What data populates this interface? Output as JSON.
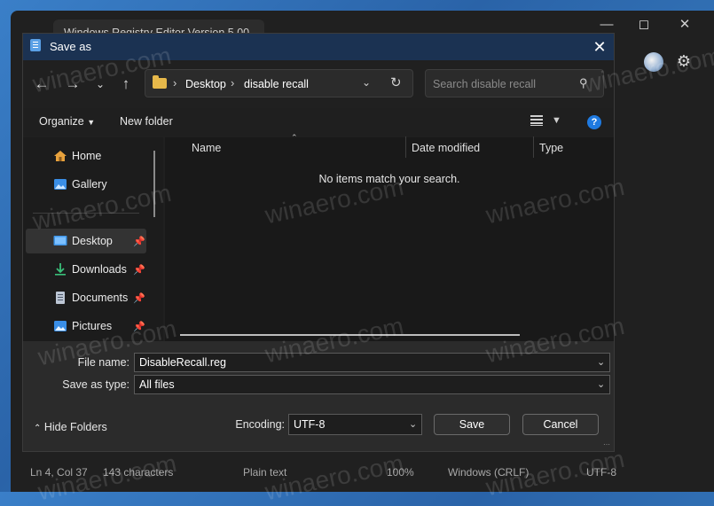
{
  "background_window": {
    "tab_title": "Windows Registry Editor Version 5.00",
    "status": {
      "position": "Ln 4, Col 37",
      "characters": "143 characters",
      "format": "Plain text",
      "zoom": "100%",
      "line_endings": "Windows (CRLF)",
      "encoding": "UTF-8"
    }
  },
  "dialog": {
    "title": "Save as",
    "address": {
      "segments": [
        "Desktop",
        "disable recall"
      ]
    },
    "search_placeholder": "Search disable recall",
    "commands": {
      "organize": "Organize",
      "new_folder": "New folder"
    },
    "nav": {
      "items": [
        {
          "label": "Home",
          "icon": "home-icon"
        },
        {
          "label": "Gallery",
          "icon": "gallery-icon"
        },
        {
          "label": "Desktop",
          "icon": "desktop-icon",
          "pinned": true,
          "selected": true
        },
        {
          "label": "Downloads",
          "icon": "download-icon",
          "pinned": true
        },
        {
          "label": "Documents",
          "icon": "document-icon",
          "pinned": true
        },
        {
          "label": "Pictures",
          "icon": "pictures-icon",
          "pinned": true
        }
      ]
    },
    "columns": [
      "Name",
      "Date modified",
      "Type"
    ],
    "empty_message": "No items match your search.",
    "file_name_label": "File name:",
    "file_name": "DisableRecall.reg",
    "save_type_label": "Save as type:",
    "save_type": "All files",
    "encoding_label": "Encoding:",
    "encoding": "UTF-8",
    "save_button": "Save",
    "cancel_button": "Cancel",
    "hide_folders": "Hide Folders"
  },
  "watermark": "winaero.com",
  "colors": {
    "titlebar": "#1b3252",
    "dialog_bg": "#202020",
    "accent": "#1f7ae0",
    "desktop_bg": "#2a63a8"
  }
}
